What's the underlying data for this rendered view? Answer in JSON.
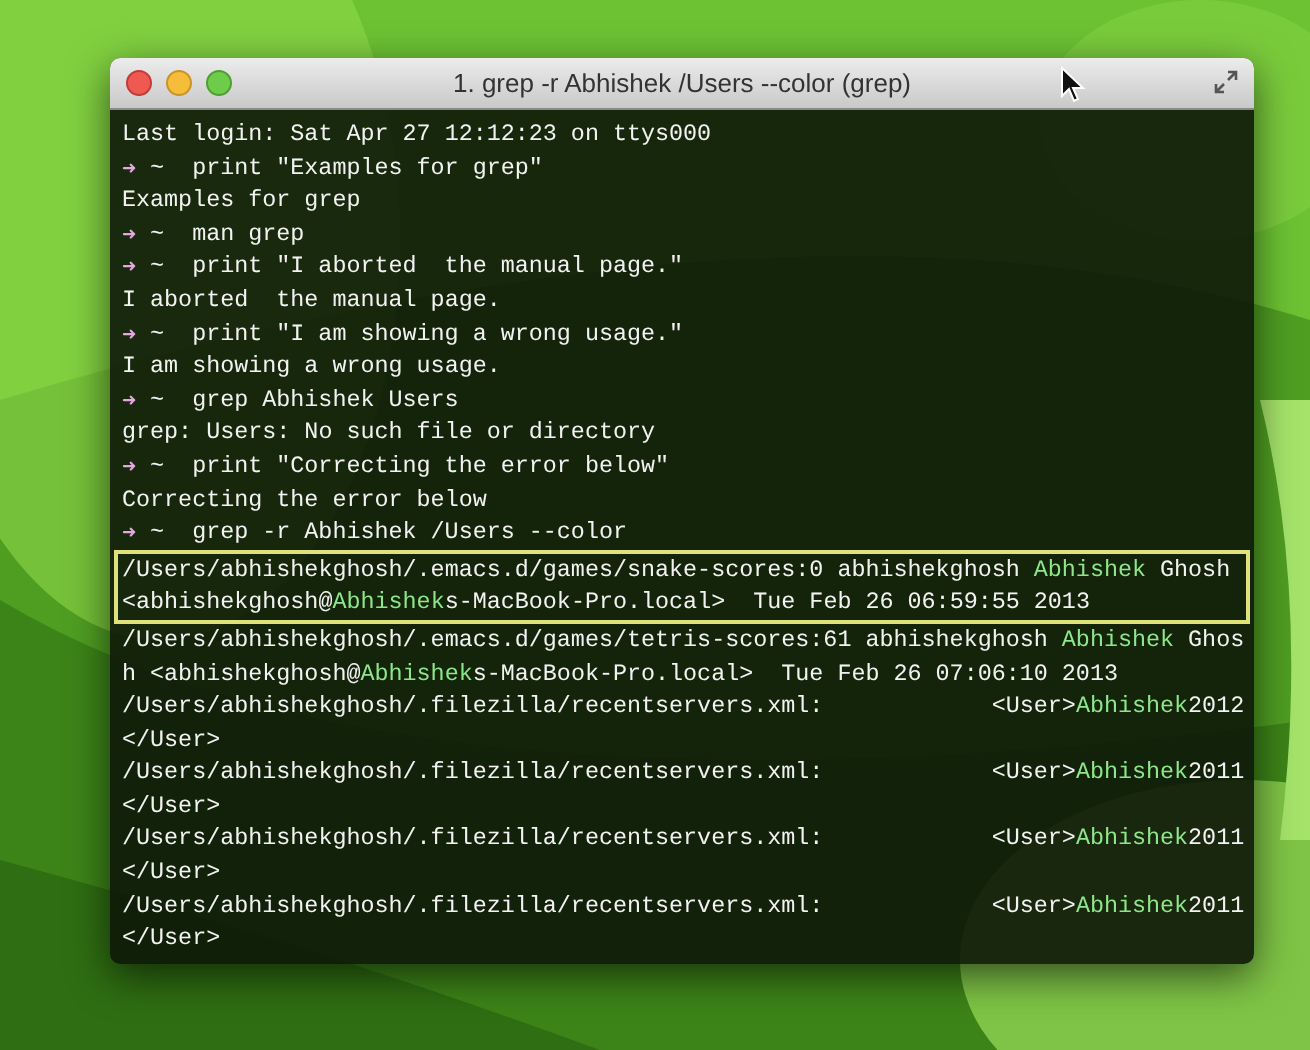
{
  "window": {
    "title": "1. grep -r Abhishek /Users --color (grep)"
  },
  "lines": [
    {
      "kind": "output",
      "highlighted": false,
      "parts": [
        {
          "text": "Last login: Sat Apr 27 12:12:23 on ttys000",
          "match": false
        }
      ]
    },
    {
      "kind": "prompt",
      "arrow": "➜",
      "cwd": "~",
      "highlighted": false,
      "parts": [
        {
          "text": "print \"Examples for grep\"",
          "match": false
        }
      ]
    },
    {
      "kind": "output",
      "highlighted": false,
      "parts": [
        {
          "text": "Examples for grep",
          "match": false
        }
      ]
    },
    {
      "kind": "prompt",
      "arrow": "➜",
      "cwd": "~",
      "highlighted": false,
      "parts": [
        {
          "text": "man grep",
          "match": false
        }
      ]
    },
    {
      "kind": "prompt",
      "arrow": "➜",
      "cwd": "~",
      "highlighted": false,
      "parts": [
        {
          "text": "print \"I aborted  the manual page.\"",
          "match": false
        }
      ]
    },
    {
      "kind": "output",
      "highlighted": false,
      "parts": [
        {
          "text": "I aborted  the manual page.",
          "match": false
        }
      ]
    },
    {
      "kind": "prompt",
      "arrow": "➜",
      "cwd": "~",
      "highlighted": false,
      "parts": [
        {
          "text": "print \"I am showing a wrong usage.\"",
          "match": false
        }
      ]
    },
    {
      "kind": "output",
      "highlighted": false,
      "parts": [
        {
          "text": "I am showing a wrong usage.",
          "match": false
        }
      ]
    },
    {
      "kind": "prompt",
      "arrow": "➜",
      "cwd": "~",
      "highlighted": false,
      "parts": [
        {
          "text": "grep Abhishek Users",
          "match": false
        }
      ]
    },
    {
      "kind": "output",
      "highlighted": false,
      "parts": [
        {
          "text": "grep: Users: No such file or directory",
          "match": false
        }
      ]
    },
    {
      "kind": "prompt",
      "arrow": "➜",
      "cwd": "~",
      "highlighted": false,
      "parts": [
        {
          "text": "print \"Correcting the error below\"",
          "match": false
        }
      ]
    },
    {
      "kind": "output",
      "highlighted": false,
      "parts": [
        {
          "text": "Correcting the error below",
          "match": false
        }
      ]
    },
    {
      "kind": "prompt",
      "arrow": "➜",
      "cwd": "~",
      "highlighted": false,
      "parts": [
        {
          "text": "grep -r Abhishek /Users --color",
          "match": false
        }
      ]
    },
    {
      "kind": "output",
      "highlighted": true,
      "parts": [
        {
          "text": "/Users/abhishekghosh/.emacs.d/games/snake-scores:0 abhishekghosh ",
          "match": false
        },
        {
          "text": "Abhishek",
          "match": true
        },
        {
          "text": " Ghosh",
          "match": false
        }
      ]
    },
    {
      "kind": "output",
      "highlighted": true,
      "parts": [
        {
          "text": "<abhishekghosh@",
          "match": false
        },
        {
          "text": "Abhishek",
          "match": true
        },
        {
          "text": "s-MacBook-Pro.local>  Tue Feb 26 06:59:55 2013",
          "match": false
        }
      ]
    },
    {
      "kind": "output",
      "highlighted": false,
      "parts": [
        {
          "text": "/Users/abhishekghosh/.emacs.d/games/tetris-scores:61 abhishekghosh ",
          "match": false
        },
        {
          "text": "Abhishek",
          "match": true
        },
        {
          "text": " Ghos",
          "match": false
        }
      ]
    },
    {
      "kind": "output",
      "highlighted": false,
      "parts": [
        {
          "text": "h <abhishekghosh@",
          "match": false
        },
        {
          "text": "Abhishek",
          "match": true
        },
        {
          "text": "s-MacBook-Pro.local>  Tue Feb 26 07:06:10 2013",
          "match": false
        }
      ]
    },
    {
      "kind": "output",
      "highlighted": false,
      "parts": [
        {
          "text": "/Users/abhishekghosh/.filezilla/recentservers.xml:            <User>",
          "match": false
        },
        {
          "text": "Abhishek",
          "match": true
        },
        {
          "text": "2012",
          "match": false
        }
      ]
    },
    {
      "kind": "output",
      "highlighted": false,
      "parts": [
        {
          "text": "</User>",
          "match": false
        }
      ]
    },
    {
      "kind": "output",
      "highlighted": false,
      "parts": [
        {
          "text": "/Users/abhishekghosh/.filezilla/recentservers.xml:            <User>",
          "match": false
        },
        {
          "text": "Abhishek",
          "match": true
        },
        {
          "text": "2011",
          "match": false
        }
      ]
    },
    {
      "kind": "output",
      "highlighted": false,
      "parts": [
        {
          "text": "</User>",
          "match": false
        }
      ]
    },
    {
      "kind": "output",
      "highlighted": false,
      "parts": [
        {
          "text": "/Users/abhishekghosh/.filezilla/recentservers.xml:            <User>",
          "match": false
        },
        {
          "text": "Abhishek",
          "match": true
        },
        {
          "text": "2011",
          "match": false
        }
      ]
    },
    {
      "kind": "output",
      "highlighted": false,
      "parts": [
        {
          "text": "</User>",
          "match": false
        }
      ]
    },
    {
      "kind": "output",
      "highlighted": false,
      "parts": [
        {
          "text": "/Users/abhishekghosh/.filezilla/recentservers.xml:            <User>",
          "match": false
        },
        {
          "text": "Abhishek",
          "match": true
        },
        {
          "text": "2011",
          "match": false
        }
      ]
    },
    {
      "kind": "output",
      "highlighted": false,
      "parts": [
        {
          "text": "</User>",
          "match": false
        }
      ]
    }
  ]
}
